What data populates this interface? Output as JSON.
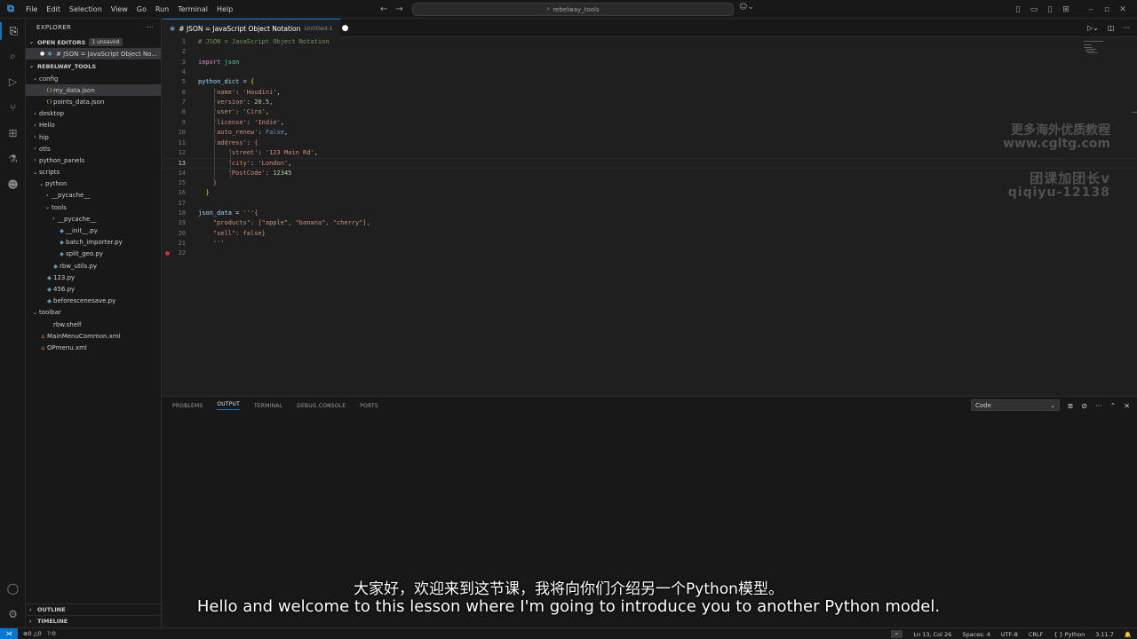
{
  "menu": [
    "File",
    "Edit",
    "Selection",
    "View",
    "Go",
    "Run",
    "Terminal",
    "Help"
  ],
  "search": {
    "label": "rebelway_tools"
  },
  "explorer": {
    "title": "EXPLORER",
    "open_editors_label": "OPEN EDITORS",
    "unsaved_badge": "1 unsaved",
    "open_editor_item": "# JSON = JavaScript Object No...",
    "folder_label": "REBELWAY_TOOLS",
    "tree": [
      {
        "label": "config",
        "type": "folder-open",
        "indent": 0
      },
      {
        "label": "my_data.json",
        "type": "json",
        "indent": 1,
        "selected": true
      },
      {
        "label": "points_data.json",
        "type": "json",
        "indent": 1
      },
      {
        "label": "desktop",
        "type": "folder",
        "indent": 0
      },
      {
        "label": "Hello",
        "type": "folder",
        "indent": 0
      },
      {
        "label": "hip",
        "type": "folder",
        "indent": 0
      },
      {
        "label": "otls",
        "type": "folder",
        "indent": 0
      },
      {
        "label": "python_panels",
        "type": "folder",
        "indent": 0
      },
      {
        "label": "scripts",
        "type": "folder-open",
        "indent": 0
      },
      {
        "label": "python",
        "type": "folder-open",
        "indent": 1
      },
      {
        "label": "__pycache__",
        "type": "folder",
        "indent": 2
      },
      {
        "label": "tools",
        "type": "folder-open",
        "indent": 2
      },
      {
        "label": "__pycache__",
        "type": "folder",
        "indent": 3
      },
      {
        "label": "__init__.py",
        "type": "py",
        "indent": 3
      },
      {
        "label": "batch_importer.py",
        "type": "py",
        "indent": 3
      },
      {
        "label": "split_geo.py",
        "type": "py",
        "indent": 3
      },
      {
        "label": "rbw_utils.py",
        "type": "py",
        "indent": 2
      },
      {
        "label": "123.py",
        "type": "py",
        "indent": 1
      },
      {
        "label": "456.py",
        "type": "py",
        "indent": 1
      },
      {
        "label": "beforescenesave.py",
        "type": "py",
        "indent": 1
      },
      {
        "label": "toolbar",
        "type": "folder-open",
        "indent": 0
      },
      {
        "label": "rbw.shelf",
        "type": "file",
        "indent": 1
      },
      {
        "label": "MainMenuCommon.xml",
        "type": "xml",
        "indent": 0
      },
      {
        "label": "OPmenu.xml",
        "type": "xml",
        "indent": 0
      }
    ],
    "outline_label": "OUTLINE",
    "timeline_label": "TIMELINE"
  },
  "tab": {
    "title": "# JSON = JavaScript Object Notation",
    "subtitle": "Untitled-1"
  },
  "editor": {
    "current_line": 13,
    "breakpoint_line": 22,
    "lines": [
      [
        [
          "com",
          "# JSON = JavaScript Object Notation"
        ]
      ],
      [],
      [
        [
          "kw",
          "import"
        ],
        [
          "op",
          " "
        ],
        [
          "mod",
          "json"
        ]
      ],
      [],
      [
        [
          "var",
          "python_dict"
        ],
        [
          "op",
          " = "
        ],
        [
          "br1",
          "{"
        ]
      ],
      [
        [
          "op",
          "    "
        ],
        [
          "str",
          "'name'"
        ],
        [
          "op",
          ": "
        ],
        [
          "str",
          "'Houdini'"
        ],
        [
          "op",
          ","
        ]
      ],
      [
        [
          "op",
          "    "
        ],
        [
          "str",
          "'version'"
        ],
        [
          "op",
          ": "
        ],
        [
          "num",
          "20.5"
        ],
        [
          "op",
          ","
        ]
      ],
      [
        [
          "op",
          "    "
        ],
        [
          "str",
          "'user'"
        ],
        [
          "op",
          ": "
        ],
        [
          "str",
          "'Ciro'"
        ],
        [
          "op",
          ","
        ]
      ],
      [
        [
          "op",
          "    "
        ],
        [
          "str",
          "'license'"
        ],
        [
          "op",
          ": "
        ],
        [
          "str",
          "'Indie'"
        ],
        [
          "op",
          ","
        ]
      ],
      [
        [
          "op",
          "    "
        ],
        [
          "str",
          "'auto_renew'"
        ],
        [
          "op",
          ": "
        ],
        [
          "bool",
          "False"
        ],
        [
          "op",
          ","
        ]
      ],
      [
        [
          "op",
          "    "
        ],
        [
          "str",
          "'address'"
        ],
        [
          "op",
          ": "
        ],
        [
          "br2",
          "{"
        ]
      ],
      [
        [
          "op",
          "        "
        ],
        [
          "str",
          "'street'"
        ],
        [
          "op",
          ": "
        ],
        [
          "str",
          "'123 Main Rd'"
        ],
        [
          "op",
          ","
        ]
      ],
      [
        [
          "op",
          "        "
        ],
        [
          "str",
          "'city'"
        ],
        [
          "op",
          ": "
        ],
        [
          "str",
          "'London'"
        ],
        [
          "op",
          ","
        ]
      ],
      [
        [
          "op",
          "        "
        ],
        [
          "str",
          "'PostCode'"
        ],
        [
          "op",
          ": "
        ],
        [
          "num",
          "12345"
        ]
      ],
      [
        [
          "op",
          "    "
        ],
        [
          "br2",
          "}"
        ]
      ],
      [
        [
          "op",
          "  "
        ],
        [
          "br1",
          "}"
        ]
      ],
      [],
      [
        [
          "var",
          "json_data"
        ],
        [
          "op",
          " = "
        ],
        [
          "str",
          "'''{"
        ]
      ],
      [
        [
          "str",
          "    \"products\": [\"apple\", \"banana\", \"cherry\"],"
        ]
      ],
      [
        [
          "str",
          "    \"sell\": false}"
        ]
      ],
      [
        [
          "str",
          "    '''"
        ]
      ],
      []
    ]
  },
  "watermark": {
    "line1": "更多海外优质教程",
    "line2": "www.cgltg.com",
    "line3": "团课加团长v",
    "line4": "qiqiyu-12138"
  },
  "panel": {
    "tabs": [
      "PROBLEMS",
      "OUTPUT",
      "TERMINAL",
      "DEBUG CONSOLE",
      "PORTS"
    ],
    "active_tab": "OUTPUT",
    "select_value": "Code"
  },
  "subtitles": {
    "chinese": "大家好，欢迎来到这节课，我将向你们介绍另一个Python模型。",
    "english": "Hello and welcome to this lesson where I'm going to introduce you to another Python model."
  },
  "status": {
    "errors": "0",
    "warnings": "0",
    "ports": "0",
    "position": "Ln 13, Col 26",
    "spaces": "Spaces: 4",
    "encoding": "UTF-8",
    "eol": "CRLF",
    "language": "Python",
    "version": "3.11.7"
  }
}
